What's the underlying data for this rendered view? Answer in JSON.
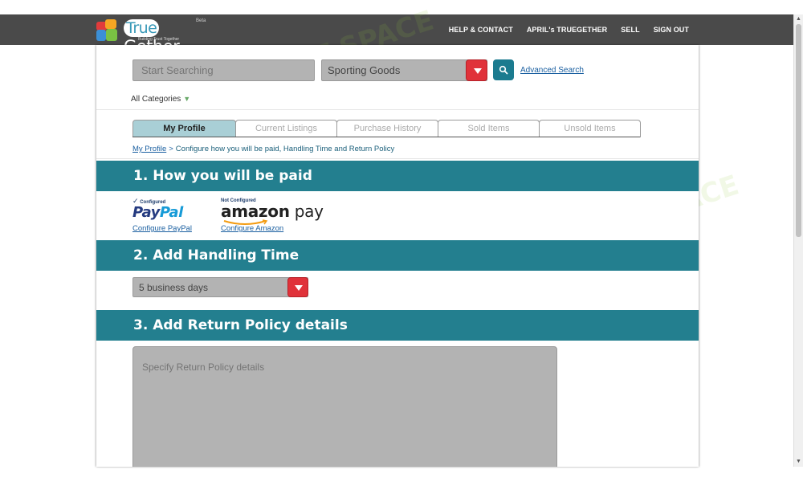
{
  "header": {
    "logo": {
      "brand_true": "True",
      "brand_gether": "Gether",
      "beta": "Beta",
      "tagline": "Building Trust Together"
    },
    "nav": [
      {
        "label": "HELP & CONTACT"
      },
      {
        "label": "APRIL's TRUEGETHER"
      },
      {
        "label": "SELL"
      },
      {
        "label": "SIGN OUT"
      }
    ]
  },
  "search": {
    "placeholder": "Start Searching",
    "category_value": "Sporting Goods",
    "advanced_label": "Advanced Search",
    "all_categories_label": "All Categories"
  },
  "tabs": [
    {
      "label": "My Profile",
      "active": true
    },
    {
      "label": "Current Listings"
    },
    {
      "label": "Purchase History"
    },
    {
      "label": "Sold Items"
    },
    {
      "label": "Unsold Items"
    }
  ],
  "breadcrumb": {
    "link": "My Profile",
    "separator": ">",
    "current": "Configure how you will be paid, Handling Time and Return Policy"
  },
  "sections": {
    "paid": {
      "title": "1. How you will be paid",
      "paypal": {
        "status": "Configured",
        "logo_pay": "Pay",
        "logo_pal": "Pal",
        "link": "Configure PayPal"
      },
      "amazon": {
        "status": "Not Configured",
        "logo_amazon": "amazon",
        "logo_pay": "pay",
        "link": "Configure Amazon"
      }
    },
    "handling": {
      "title": "2. Add Handling Time",
      "value": "5 business days"
    },
    "return_policy": {
      "title": "3. Add Return Policy details",
      "placeholder": "Specify Return Policy details"
    }
  },
  "watermark": {
    "text": "AI TALENT SPACE"
  },
  "colors": {
    "topbar": "#4a4a4a",
    "section_header": "#237f8f",
    "active_tab": "#a9cfd6",
    "dropdown_button": "#e0323a",
    "search_button": "#1b7b8f",
    "link": "#1a5fa0"
  }
}
